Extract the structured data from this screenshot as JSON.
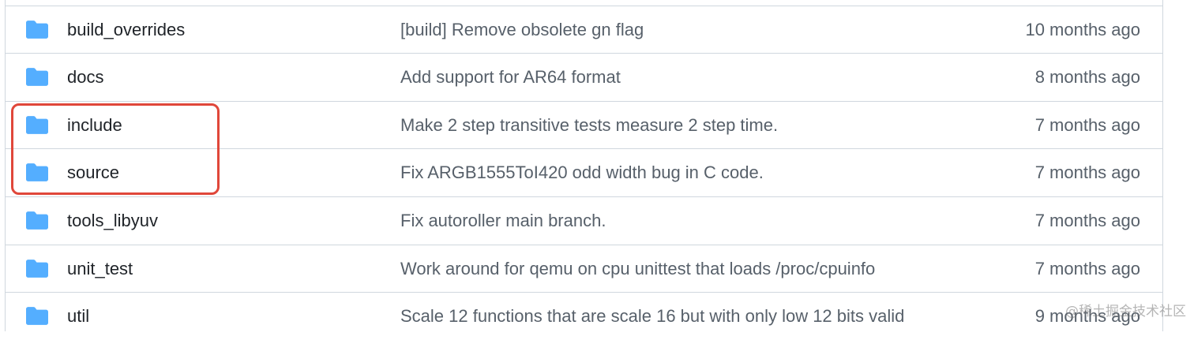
{
  "colors": {
    "folder": "#54aeff",
    "highlight": "#e0473a",
    "border": "#d0d7de"
  },
  "rows": [
    {
      "icon": "folder-icon",
      "name": "build_overrides",
      "message": "[build] Remove obsolete gn flag",
      "age": "10 months ago"
    },
    {
      "icon": "folder-icon",
      "name": "docs",
      "message": "Add support for AR64 format",
      "age": "8 months ago"
    },
    {
      "icon": "folder-icon",
      "name": "include",
      "message": "Make 2 step transitive tests measure 2 step time.",
      "age": "7 months ago"
    },
    {
      "icon": "folder-icon",
      "name": "source",
      "message": "Fix ARGB1555ToI420 odd width bug in C code.",
      "age": "7 months ago"
    },
    {
      "icon": "folder-icon",
      "name": "tools_libyuv",
      "message": "Fix autoroller main branch.",
      "age": "7 months ago"
    },
    {
      "icon": "folder-icon",
      "name": "unit_test",
      "message": "Work around for qemu on cpu unittest that loads /proc/cpuinfo",
      "age": "7 months ago"
    },
    {
      "icon": "folder-icon",
      "name": "util",
      "message": "Scale 12 functions that are scale 16 but with only low 12 bits valid",
      "age": "9 months ago"
    }
  ],
  "watermark": "@稀土掘金技术社区"
}
